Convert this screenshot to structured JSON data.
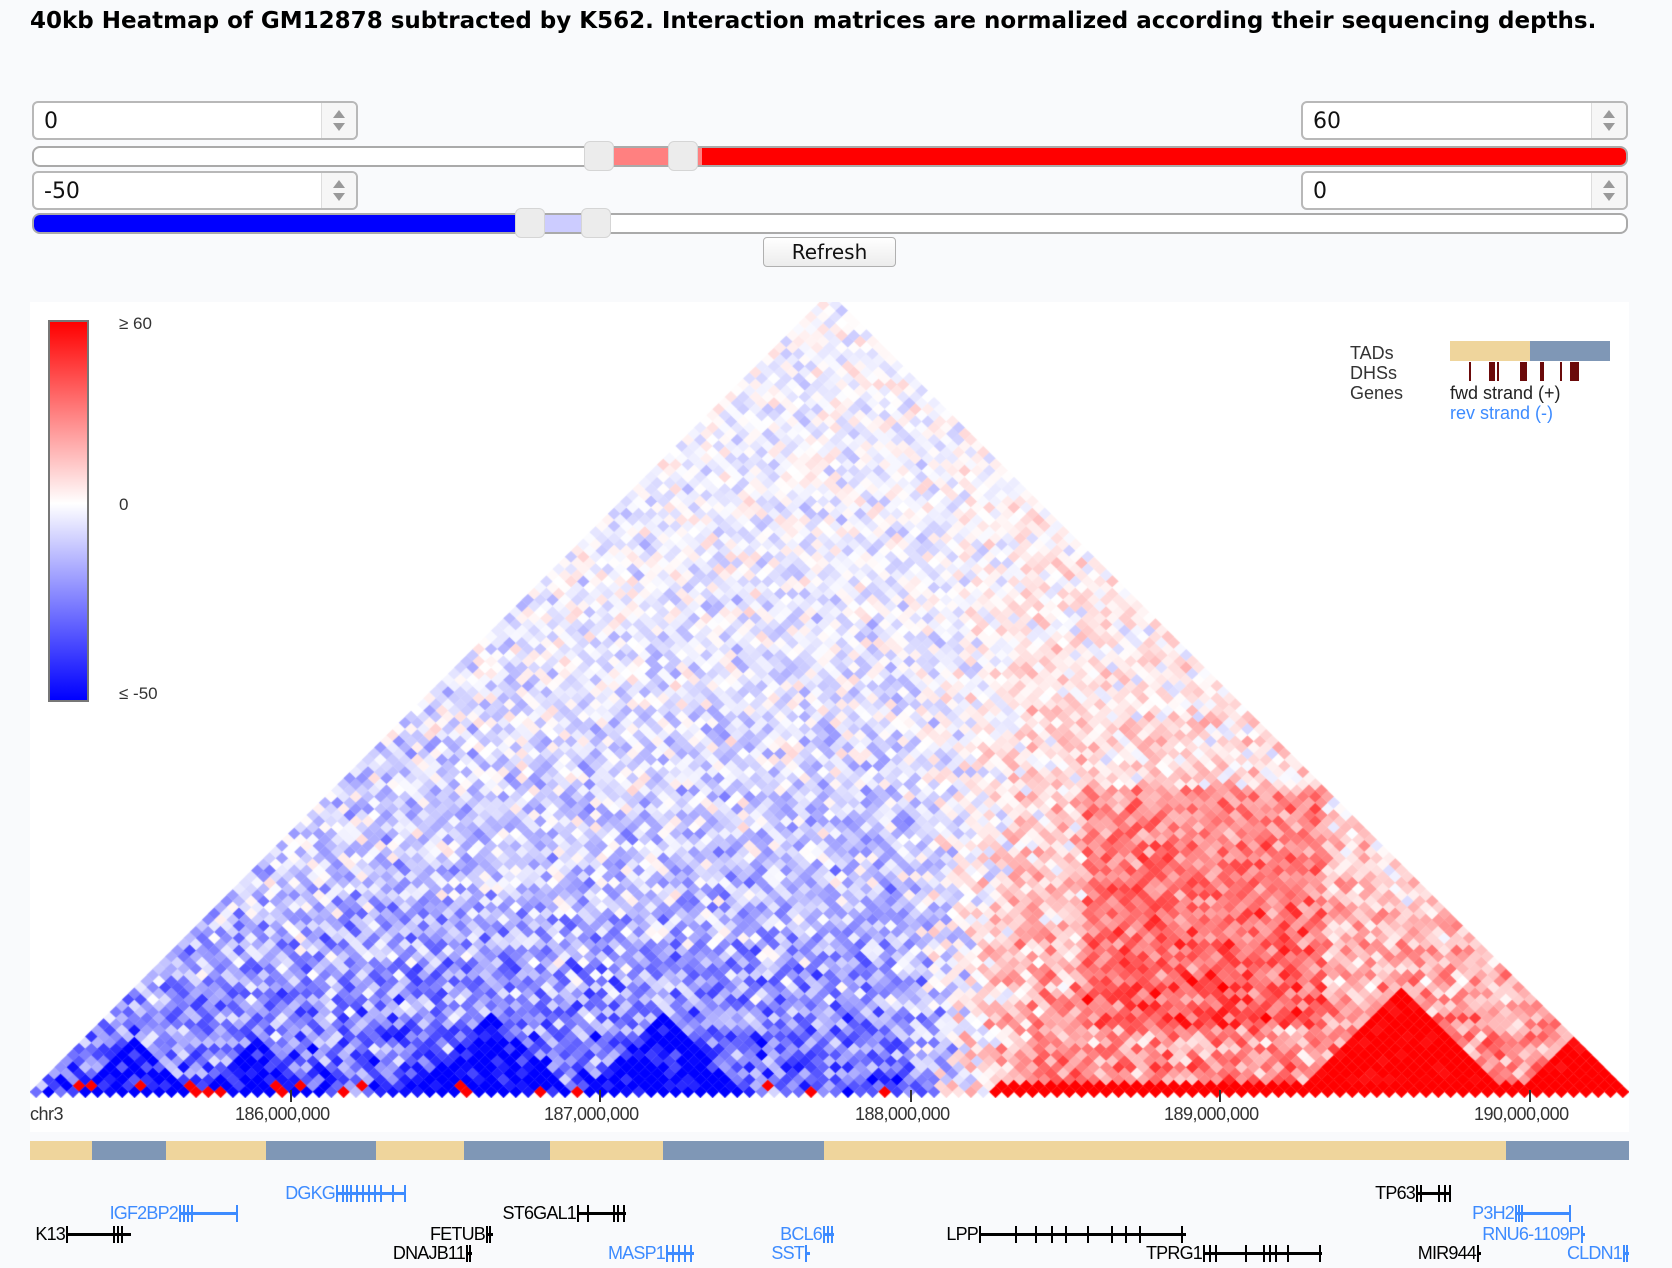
{
  "title": "40kb Heatmap of GM12878 subtracted by K562. Interaction matrices are normalized according their sequencing depths.",
  "controls": {
    "positive_min": "0",
    "positive_max": "60",
    "negative_min": "-50",
    "negative_max": "0",
    "refresh_label": "Refresh",
    "colors": {
      "positive_range": "#ff0000",
      "positive_between": "#ff8080",
      "negative_range": "#0000ff",
      "negative_between": "#ccccff"
    }
  },
  "colorbar": {
    "max_label": "≥ 60",
    "mid_label": "0",
    "min_label": "≤ -50",
    "colors": [
      "#ff0000",
      "#ffffff",
      "#0000ff"
    ]
  },
  "legend": {
    "tads_label": "TADs",
    "dhss_label": "DHSs",
    "genes_label": "Genes",
    "fwd_label": "fwd strand (+)",
    "rev_label": "rev strand (-)",
    "tad_colors": [
      "#efd59c",
      "#7f97b6"
    ],
    "dhs_color": "#6b0a0a",
    "fwd_color": "#000000",
    "rev_color": "#3d8bff"
  },
  "axis": {
    "chrom": "chr3",
    "ticks": [
      "186,000,000",
      "187,000,000",
      "188,000,000",
      "189,000,000",
      "190,000,000"
    ]
  },
  "genes": [
    {
      "name": "DGKG",
      "strand": "-"
    },
    {
      "name": "TP63",
      "strand": "+"
    },
    {
      "name": "IGF2BP2",
      "strand": "-"
    },
    {
      "name": "ST6GAL1",
      "strand": "+"
    },
    {
      "name": "P3H2",
      "strand": "-"
    },
    {
      "name": "K13",
      "strand": "+"
    },
    {
      "name": "FETUB",
      "strand": "+"
    },
    {
      "name": "BCL6",
      "strand": "-"
    },
    {
      "name": "LPP",
      "strand": "+"
    },
    {
      "name": "RNU6-1109P",
      "strand": "-"
    },
    {
      "name": "DNAJB11",
      "strand": "+"
    },
    {
      "name": "MASP1",
      "strand": "-"
    },
    {
      "name": "SST",
      "strand": "-"
    },
    {
      "name": "TPRG1",
      "strand": "+"
    },
    {
      "name": "MIR944",
      "strand": "+"
    },
    {
      "name": "CLDN1",
      "strand": "-"
    }
  ]
}
